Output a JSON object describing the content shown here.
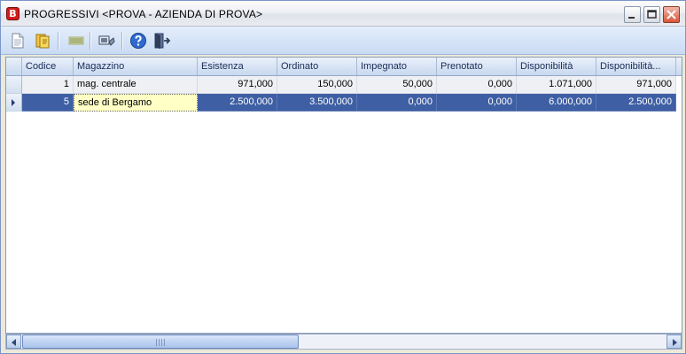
{
  "window": {
    "app_icon_letter": "B",
    "title": "PROGRESSIVI <PROVA - AZIENDA DI PROVA>"
  },
  "toolbar": {
    "buttons": [
      {
        "icon": "new-document-icon"
      },
      {
        "icon": "open-folder-icon"
      },
      {
        "icon": "barcode-icon"
      },
      {
        "icon": "tools-icon"
      },
      {
        "icon": "help-icon"
      },
      {
        "icon": "exit-door-icon"
      }
    ]
  },
  "grid": {
    "columns": [
      "Codice",
      "Magazzino",
      "Esistenza",
      "Ordinato",
      "Impegnato",
      "Prenotato",
      "Disponibilità",
      "Disponibilità..."
    ],
    "rows": [
      {
        "codice": "1",
        "magazzino": "mag. centrale",
        "esistenza": "971,000",
        "ordinato": "150,000",
        "impegnato": "50,000",
        "prenotato": "0,000",
        "disponibilita": "1.071,000",
        "disponibilita2": "971,000"
      },
      {
        "codice": "5",
        "magazzino": "sede di Bergamo",
        "esistenza": "2.500,000",
        "ordinato": "3.500,000",
        "impegnato": "0,000",
        "prenotato": "0,000",
        "disponibilita": "6.000,000",
        "disponibilita2": "2.500,000"
      }
    ],
    "selected_row": 1
  },
  "scrollbar": {
    "grip_label": "III"
  },
  "colors": {
    "selection": "#3f5fa4",
    "focus_cell": "#ffffc6",
    "close_button": "#d9553a"
  }
}
